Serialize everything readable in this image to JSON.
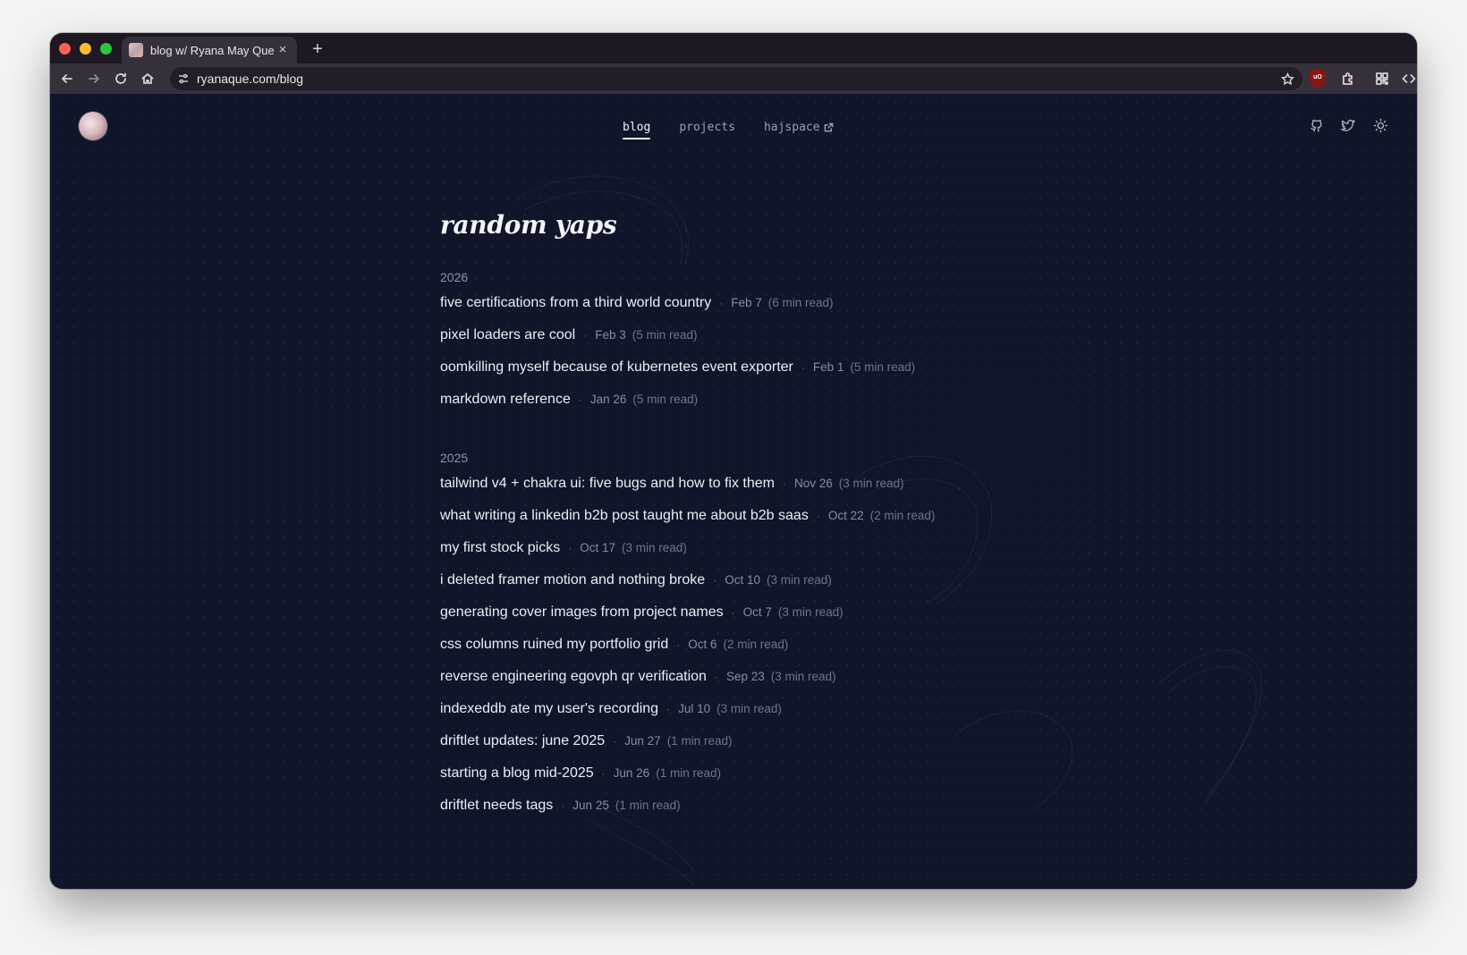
{
  "browser": {
    "tab": {
      "title": "blog w/ Ryana May Que",
      "close_glyph": "×"
    },
    "new_tab_glyph": "+",
    "address": {
      "url": "ryanaque.com/blog"
    },
    "extension_badge": "uO"
  },
  "nav": {
    "items": [
      {
        "label": "blog",
        "active": true
      },
      {
        "label": "projects",
        "active": false
      },
      {
        "label": "hajspace",
        "active": false,
        "external": true
      }
    ]
  },
  "header_icons": [
    "github-icon",
    "twitter-icon",
    "sun-icon"
  ],
  "page": {
    "title": "random yaps",
    "sections": [
      {
        "year": "2026",
        "posts": [
          {
            "title": "five certifications from a third world country",
            "date": "Feb 7",
            "read": "(6 min read)"
          },
          {
            "title": "pixel loaders are cool",
            "date": "Feb 3",
            "read": "(5 min read)"
          },
          {
            "title": "oomkilling myself because of kubernetes event exporter",
            "date": "Feb 1",
            "read": "(5 min read)"
          },
          {
            "title": "markdown reference",
            "date": "Jan 26",
            "read": "(5 min read)"
          }
        ]
      },
      {
        "year": "2025",
        "posts": [
          {
            "title": "tailwind v4 + chakra ui: five bugs and how to fix them",
            "date": "Nov 26",
            "read": "(3 min read)"
          },
          {
            "title": "what writing a linkedin b2b post taught me about b2b saas",
            "date": "Oct 22",
            "read": "(2 min read)"
          },
          {
            "title": "my first stock picks",
            "date": "Oct 17",
            "read": "(3 min read)"
          },
          {
            "title": "i deleted framer motion and nothing broke",
            "date": "Oct 10",
            "read": "(3 min read)"
          },
          {
            "title": "generating cover images from project names",
            "date": "Oct 7",
            "read": "(3 min read)"
          },
          {
            "title": "css columns ruined my portfolio grid",
            "date": "Oct 6",
            "read": "(2 min read)"
          },
          {
            "title": "reverse engineering egovph qr verification",
            "date": "Sep 23",
            "read": "(3 min read)"
          },
          {
            "title": "indexeddb ate my user's recording",
            "date": "Jul 10",
            "read": "(3 min read)"
          },
          {
            "title": "driftlet updates: june 2025",
            "date": "Jun 27",
            "read": "(1 min read)"
          },
          {
            "title": "starting a blog mid-2025",
            "date": "Jun 26",
            "read": "(1 min read)"
          },
          {
            "title": "driftlet needs tags",
            "date": "Jun 25",
            "read": "(1 min read)"
          }
        ]
      }
    ],
    "separator": "·"
  },
  "colors": {
    "page_bg": "#10152a",
    "text_primary": "#eceef4",
    "text_muted": "#878da1",
    "chrome_toolbar": "#36303b",
    "chrome_tabstrip": "#1d1822"
  }
}
